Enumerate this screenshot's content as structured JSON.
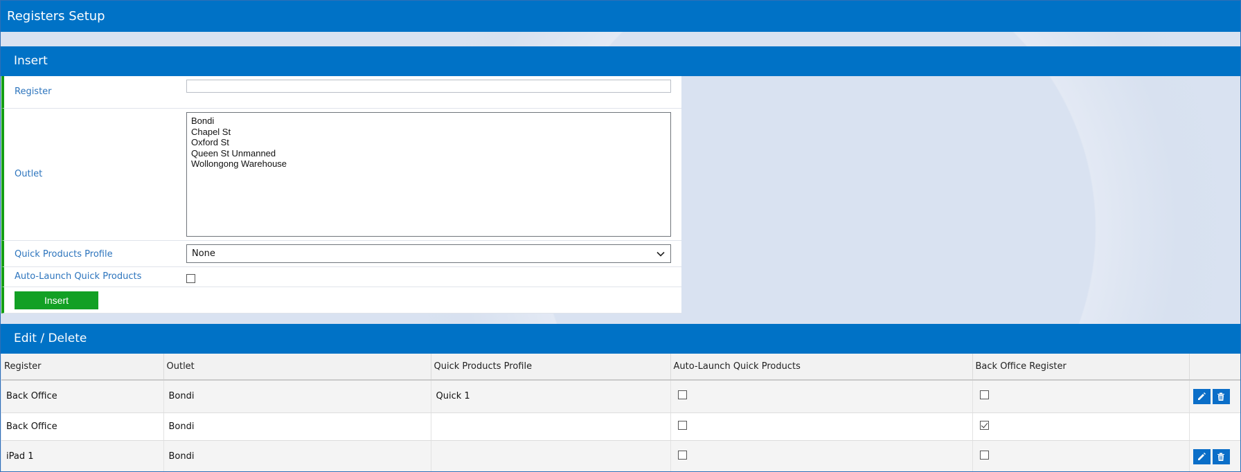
{
  "window": {
    "title": "Registers Setup"
  },
  "insert": {
    "section_title": "Insert",
    "register": {
      "label": "Register",
      "value": ""
    },
    "outlet": {
      "label": "Outlet",
      "options": [
        "Bondi",
        "Chapel St",
        "Oxford St",
        "Queen St Unmanned",
        "Wollongong Warehouse"
      ]
    },
    "quick_products_profile": {
      "label": "Quick Products Profile",
      "value": "None"
    },
    "auto_launch": {
      "label": "Auto-Launch Quick Products",
      "checked": false
    },
    "insert_button": "Insert"
  },
  "edit": {
    "section_title": "Edit / Delete",
    "columns": [
      "Register",
      "Outlet",
      "Quick Products Profile",
      "Auto-Launch Quick Products",
      "Back Office Register",
      ""
    ],
    "rows": [
      {
        "register": "Back Office",
        "outlet": "Bondi",
        "profile": "Quick 1",
        "auto_launch": false,
        "back_office": false,
        "actions": true
      },
      {
        "register": "Back Office",
        "outlet": "Bondi",
        "profile": "",
        "auto_launch": false,
        "back_office": true,
        "actions": false
      },
      {
        "register": "iPad 1",
        "outlet": "Bondi",
        "profile": "",
        "auto_launch": false,
        "back_office": false,
        "actions": true
      }
    ]
  },
  "colors": {
    "header_blue": "#0072c6",
    "accent_green": "#12a024",
    "label_blue": "#2c74bd"
  }
}
